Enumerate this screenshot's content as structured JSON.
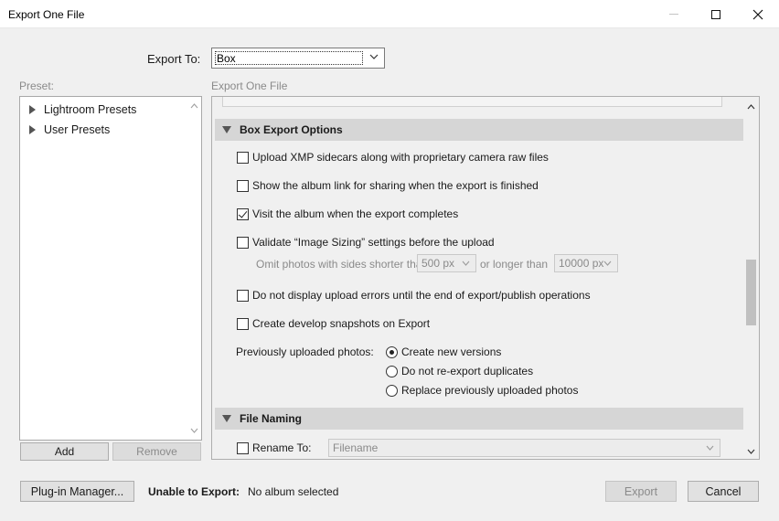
{
  "window": {
    "title": "Export One File"
  },
  "export_to": {
    "label": "Export To:",
    "value": "Box"
  },
  "preset": {
    "label": "Preset:",
    "items": [
      {
        "label": "Lightroom Presets"
      },
      {
        "label": "User Presets"
      }
    ],
    "add_label": "Add",
    "remove_label": "Remove"
  },
  "panel": {
    "label": "Export One File",
    "sections": {
      "box_export": {
        "title": "Box Export Options"
      },
      "file_naming": {
        "title": "File Naming"
      }
    },
    "options": {
      "upload_xmp": {
        "label": "Upload XMP sidecars along with proprietary camera raw files",
        "checked": false
      },
      "show_album_link": {
        "label": "Show the album link for sharing when the export is finished",
        "checked": false
      },
      "visit_album": {
        "label": "Visit the album when the export completes",
        "checked": true
      },
      "validate_sizing": {
        "label": "Validate “Image Sizing” settings before the upload",
        "checked": false
      },
      "no_display_errors": {
        "label": "Do not display upload errors until the end of export/publish operations",
        "checked": false
      },
      "develop_snapshots": {
        "label": "Create develop snapshots on Export",
        "checked": false
      }
    },
    "omit": {
      "label": "Omit photos with sides shorter than",
      "shorter_value": "500 px",
      "or_longer": "or longer than",
      "longer_value": "10000 px"
    },
    "previously_uploaded": {
      "label": "Previously uploaded photos:",
      "choices": [
        {
          "label": "Create new versions",
          "selected": true
        },
        {
          "label": "Do not re-export duplicates",
          "selected": false
        },
        {
          "label": "Replace previously uploaded photos",
          "selected": false
        }
      ]
    },
    "rename": {
      "label": "Rename To:",
      "value": "Filename",
      "checked": false
    }
  },
  "footer": {
    "plugin_manager": "Plug-in Manager...",
    "unable_label": "Unable to Export:",
    "status": "No album selected",
    "export_label": "Export",
    "cancel_label": "Cancel"
  }
}
